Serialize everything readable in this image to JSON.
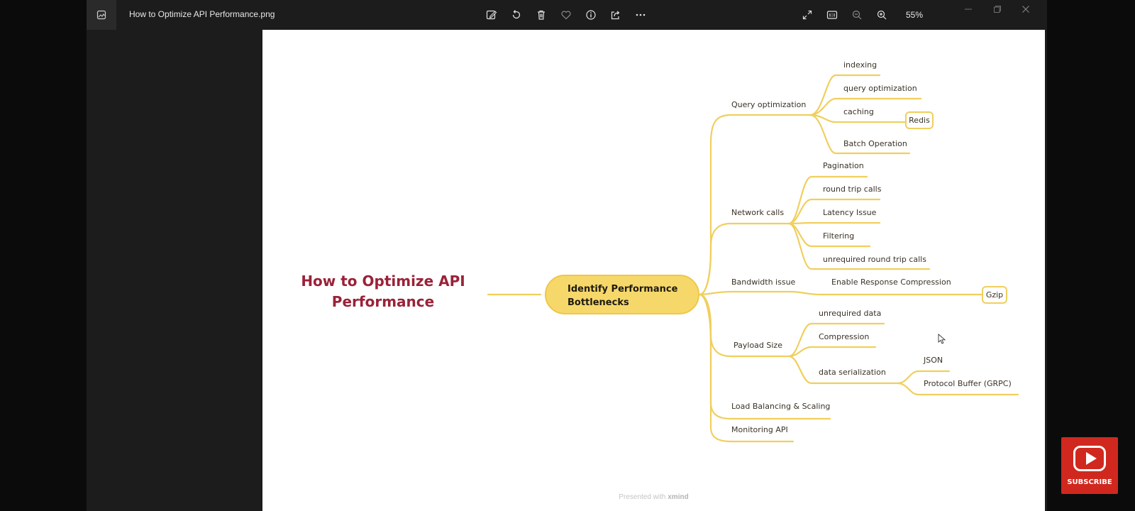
{
  "window": {
    "file_name": "How to Optimize API Performance.png",
    "zoom": "55%",
    "toolbar_icons": [
      "edit-icon",
      "rotate-icon",
      "delete-icon",
      "favorite-icon",
      "info-icon",
      "share-icon",
      "more-icon"
    ],
    "view_icons": [
      "fullscreen-icon",
      "actual-size-icon",
      "zoom-out-icon",
      "zoom-in-icon"
    ],
    "controls": [
      "minimize-icon",
      "restore-icon",
      "close-icon"
    ]
  },
  "mindmap": {
    "root": "How to Optimize API Performance",
    "center": "Identify Performance Bottlenecks",
    "query": {
      "label": "Query optimization",
      "indexing": "indexing",
      "query_opt": "query optimization",
      "caching": "caching",
      "redis": "Redis",
      "batch": "Batch Operation"
    },
    "network": {
      "label": "Network calls",
      "pagination": "Pagination",
      "round_trip": "round trip calls",
      "latency": "Latency Issue",
      "filtering": "Filtering",
      "unrequired_rt": "unrequired round trip calls"
    },
    "bandwidth": {
      "label": "Bandwidth issue",
      "compression": "Enable Response Compression",
      "gzip": "Gzip"
    },
    "payload": {
      "label": "Payload Size",
      "unrequired": "unrequired data",
      "compression": "Compression",
      "serialization": "data serialization",
      "json": "JSON",
      "protobuf": "Protocol Buffer (GRPC)"
    },
    "load_balancing": "Load Balancing & Scaling",
    "monitoring": "Monitoring API"
  },
  "footer": {
    "prefix": "Presented with",
    "brand": "xmind"
  },
  "subscribe": {
    "label": "SUBSCRIBE"
  },
  "colors": {
    "branch": "#f0cf5e",
    "root_text": "#9a2238",
    "center_fill": "#f6d86a"
  }
}
